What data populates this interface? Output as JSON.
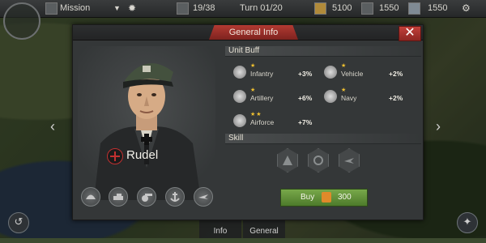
{
  "topbar": {
    "mode_label": "Mission",
    "units": "19/38",
    "turn": "Turn 01/20",
    "gold": "5100",
    "steel": "1550",
    "oil": "1550"
  },
  "dialog": {
    "title": "General Info",
    "close_symbol": "✕",
    "general_name": "Rudel",
    "unit_buff_header": "Unit Buff",
    "skill_header": "Skill",
    "buffs": [
      {
        "name": "Infantry",
        "value": "+3%",
        "stars": "★",
        "icon": "infantry-icon"
      },
      {
        "name": "Vehicle",
        "value": "+2%",
        "stars": "★",
        "icon": "vehicle-icon"
      },
      {
        "name": "Artillery",
        "value": "+6%",
        "stars": "★",
        "icon": "artillery-icon"
      },
      {
        "name": "Navy",
        "value": "+2%",
        "stars": "★",
        "icon": "navy-icon"
      },
      {
        "name": "Airforce",
        "value": "+7%",
        "stars": "★★",
        "icon": "airforce-icon"
      }
    ],
    "buy": {
      "label": "Buy",
      "price": "300"
    }
  },
  "nav": {
    "left_arrow": "‹",
    "right_arrow": "›"
  },
  "bottom_tabs": {
    "info": "Info",
    "general": "General"
  },
  "colors": {
    "accent_red": "#b23a32",
    "buy_green": "#5f8f36",
    "star_gold": "#f0c030"
  }
}
